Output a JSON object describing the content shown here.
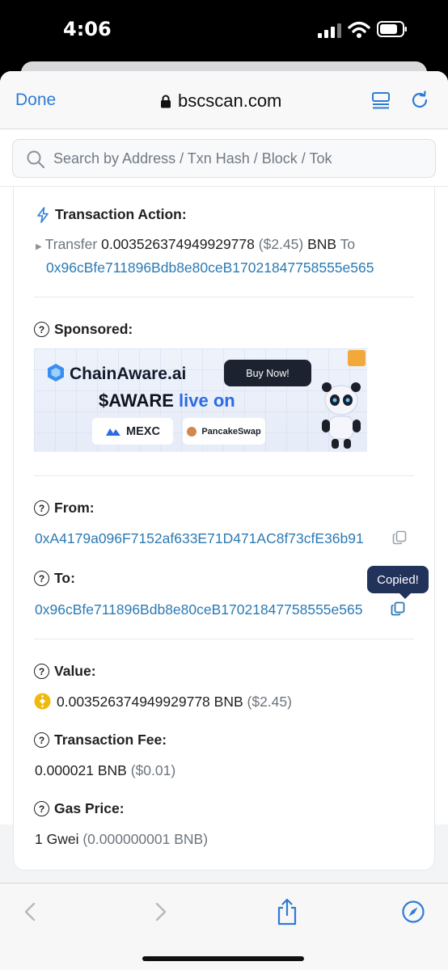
{
  "status": {
    "time": "4:06"
  },
  "browser": {
    "done_label": "Done",
    "url": "bscscan.com"
  },
  "search": {
    "placeholder": "Search by Address / Txn Hash / Block / Tok"
  },
  "tx_action": {
    "label": "Transaction Action:",
    "prefix": "Transfer",
    "amount": "0.003526374949929778",
    "usd": "($2.45)",
    "unit": "BNB",
    "to_word": "To",
    "to_address": "0x96cBfe711896Bdb8e80ceB17021847758555e565"
  },
  "sponsored": {
    "label": "Sponsored:",
    "ad": {
      "brand": "ChainAware.ai",
      "buy": "Buy Now!",
      "headline_a": "$AWARE",
      "headline_b": "live on",
      "exchange_1": "MEXC",
      "exchange_2": "PancakeSwap"
    }
  },
  "from": {
    "label": "From:",
    "address": "0xA4179a096F7152af633E71D471AC8f73cfE36b91"
  },
  "to": {
    "label": "To:",
    "address": "0x96cBfe711896Bdb8e80ceB17021847758555e565",
    "tooltip": "Copied!"
  },
  "value": {
    "label": "Value:",
    "amount": "0.003526374949929778 BNB",
    "usd": "($2.45)"
  },
  "fee": {
    "label": "Transaction Fee:",
    "amount": "0.000021 BNB",
    "usd": "($0.01)"
  },
  "gas": {
    "label": "Gas Price:",
    "amount": "1 Gwei",
    "detail": "(0.000000001 BNB)"
  },
  "colors": {
    "link": "#2c7ab3",
    "accent": "#2e7cd6",
    "tooltip_bg": "#21325b"
  }
}
